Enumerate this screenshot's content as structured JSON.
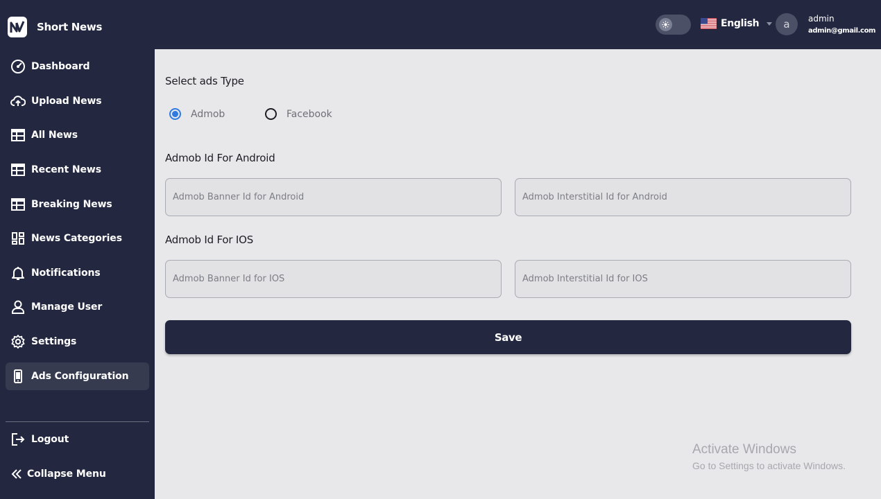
{
  "app": {
    "brand": "Short News"
  },
  "header": {
    "language": "English",
    "user_initial": "a",
    "user_name": "admin",
    "user_email": "admin@gmail.com"
  },
  "sidebar": {
    "items": [
      {
        "label": "Dashboard",
        "icon": "dashboard-icon"
      },
      {
        "label": "Upload News",
        "icon": "cloud-upload-icon"
      },
      {
        "label": "All News",
        "icon": "table-icon"
      },
      {
        "label": "Recent News",
        "icon": "table-icon"
      },
      {
        "label": "Breaking News",
        "icon": "table-icon"
      },
      {
        "label": "News Categories",
        "icon": "grid-icon"
      },
      {
        "label": "Notifications",
        "icon": "bell-icon"
      },
      {
        "label": "Manage User",
        "icon": "user-icon"
      },
      {
        "label": "Settings",
        "icon": "gear-icon"
      },
      {
        "label": "Ads Configuration",
        "icon": "phone-icon",
        "active": true
      }
    ],
    "logout": "Logout",
    "collapse": "Collapse Menu"
  },
  "main": {
    "ads_type_title": "Select ads Type",
    "radio_admob": "Admob",
    "radio_facebook": "Facebook",
    "selected_ads_type": "Admob",
    "android_title": "Admob Id For Android",
    "android_banner_placeholder": "Admob Banner Id for Android",
    "android_interstitial_placeholder": "Admob Interstitial Id for Android",
    "ios_title": "Admob Id For IOS",
    "ios_banner_placeholder": "Admob Banner Id for IOS",
    "ios_interstitial_placeholder": "Admob Interstitial Id for IOS",
    "save": "Save"
  },
  "watermark": {
    "title": "Activate Windows",
    "subtitle": "Go to Settings to activate Windows."
  },
  "colors": {
    "sidebar_bg": "#232840",
    "main_bg": "#e8e8ea",
    "accent": "#2d7be0"
  }
}
